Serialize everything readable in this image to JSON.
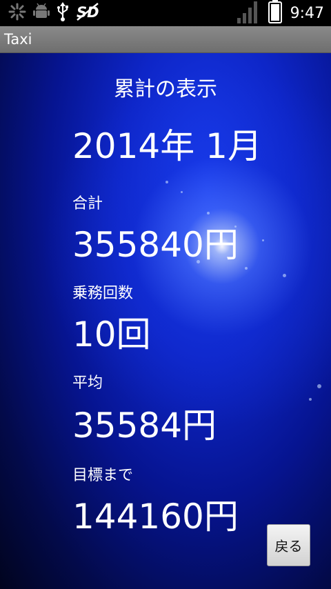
{
  "status_bar": {
    "time": "9:47",
    "icons": [
      "loading-icon",
      "android-debug-icon",
      "usb-icon",
      "sd-card-icon",
      "signal-icon",
      "battery-icon"
    ]
  },
  "app": {
    "title": "Taxi"
  },
  "screen": {
    "heading": "累計の表示",
    "year": "2014年",
    "month": "1月",
    "total_label": "合計",
    "total_value": "355840円",
    "rides_label": "乗務回数",
    "rides_value": "10回",
    "average_label": "平均",
    "average_value": "35584円",
    "goal_label": "目標まで",
    "goal_value": "144160円",
    "back_label": "戻る"
  },
  "colors": {
    "background": "#0a1a9e",
    "text": "#ffffff",
    "title_bar": "#7a7a7a"
  }
}
